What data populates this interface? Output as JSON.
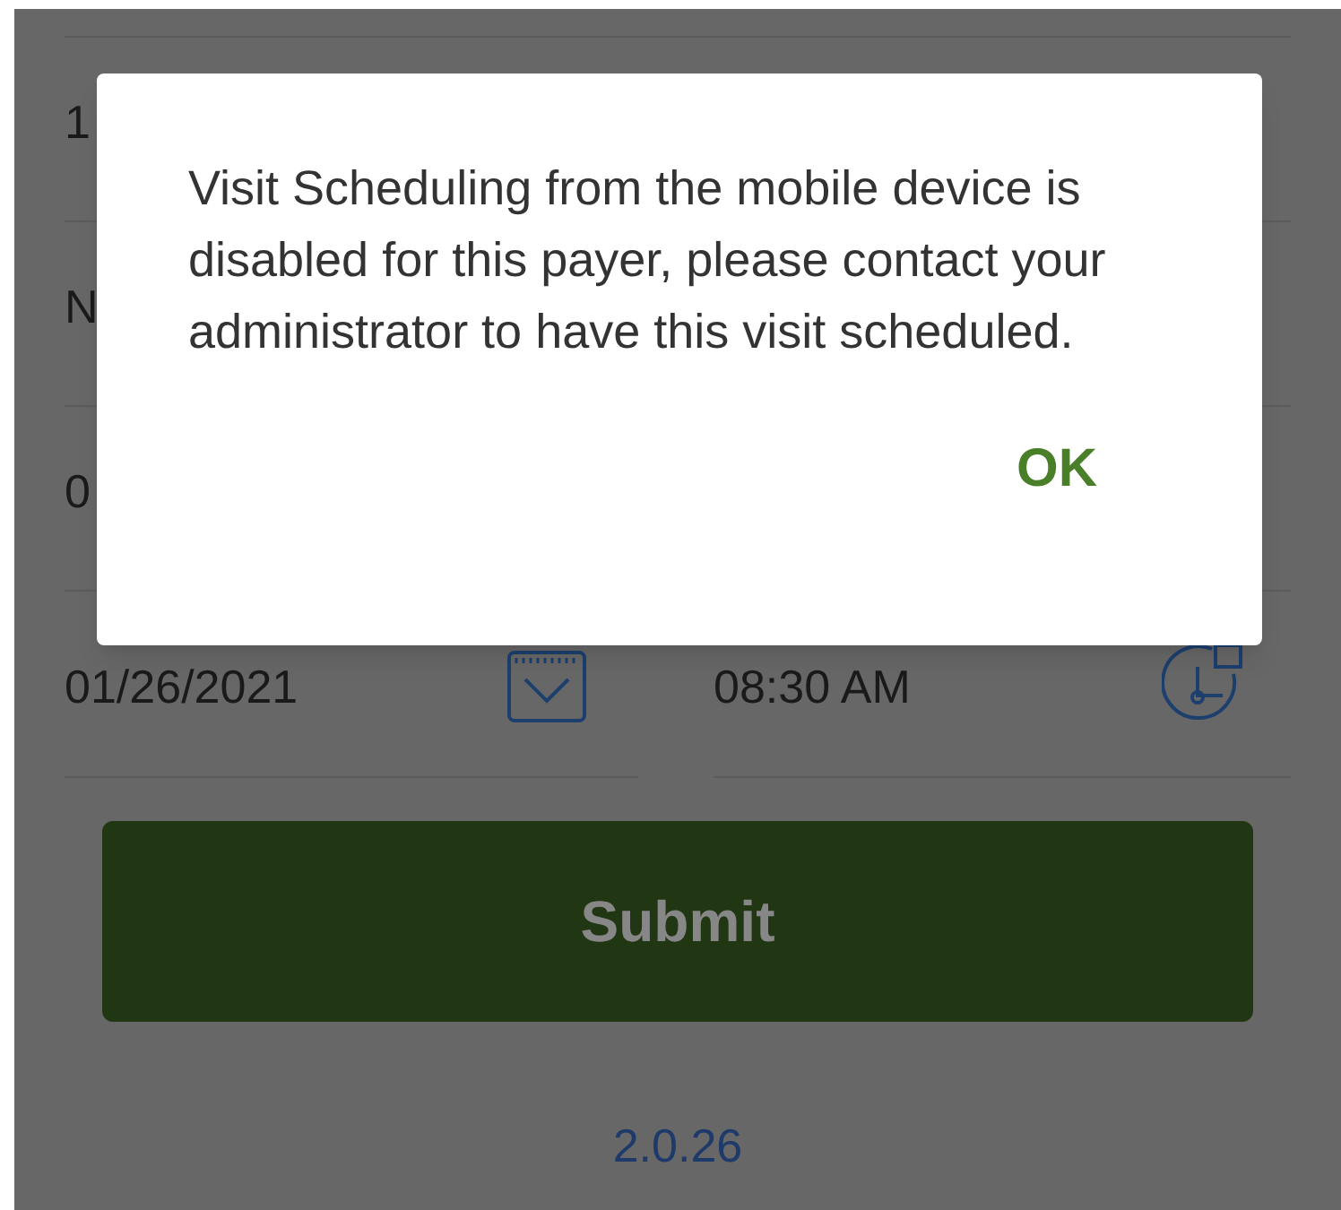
{
  "background_rows": [
    {
      "value": "1"
    },
    {
      "value": "N"
    },
    {
      "value": "0"
    }
  ],
  "date_field": {
    "value": "01/26/2021"
  },
  "time_field": {
    "value": "08:30 AM"
  },
  "submit_button": {
    "label": "Submit",
    "disabled": false
  },
  "version": "2.0.26",
  "dialog": {
    "message": "Visit Scheduling from the mobile device is disabled for this payer, please contact your administrator to have this visit scheduled.",
    "button": "OK"
  }
}
